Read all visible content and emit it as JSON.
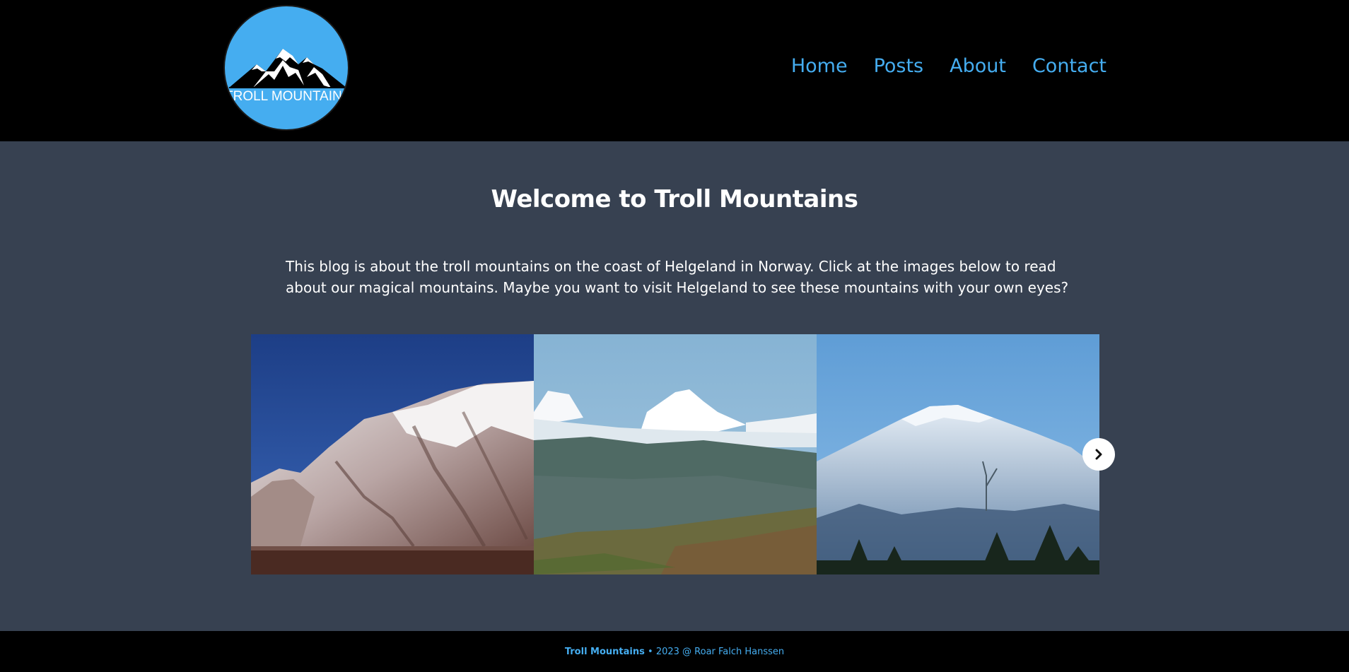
{
  "header": {
    "logo_text": "TROLL MOUNTAINS",
    "nav": [
      "Home",
      "Posts",
      "About",
      "Contact"
    ]
  },
  "main": {
    "title": "Welcome to Troll Mountains",
    "intro": "This blog is about the troll mountains on the coast of Helgeland in Norway. Click at the images below to read about our magical mountains. Maybe you want to visit Helgeland to see these mountains with your own eyes?",
    "carousel": {
      "next_icon": "chevron-right-icon",
      "slides": [
        {
          "name": "snowy-fjord-mountain"
        },
        {
          "name": "glacier-peak-valley"
        },
        {
          "name": "snow-covered-hill"
        }
      ]
    }
  },
  "footer": {
    "brand": "Troll Mountains",
    "separator": "•",
    "text": "2023 @ Roar Falch Hanssen"
  },
  "colors": {
    "header_bg": "#000000",
    "main_bg": "#374151",
    "accent": "#45adf0",
    "text": "#ffffff"
  }
}
